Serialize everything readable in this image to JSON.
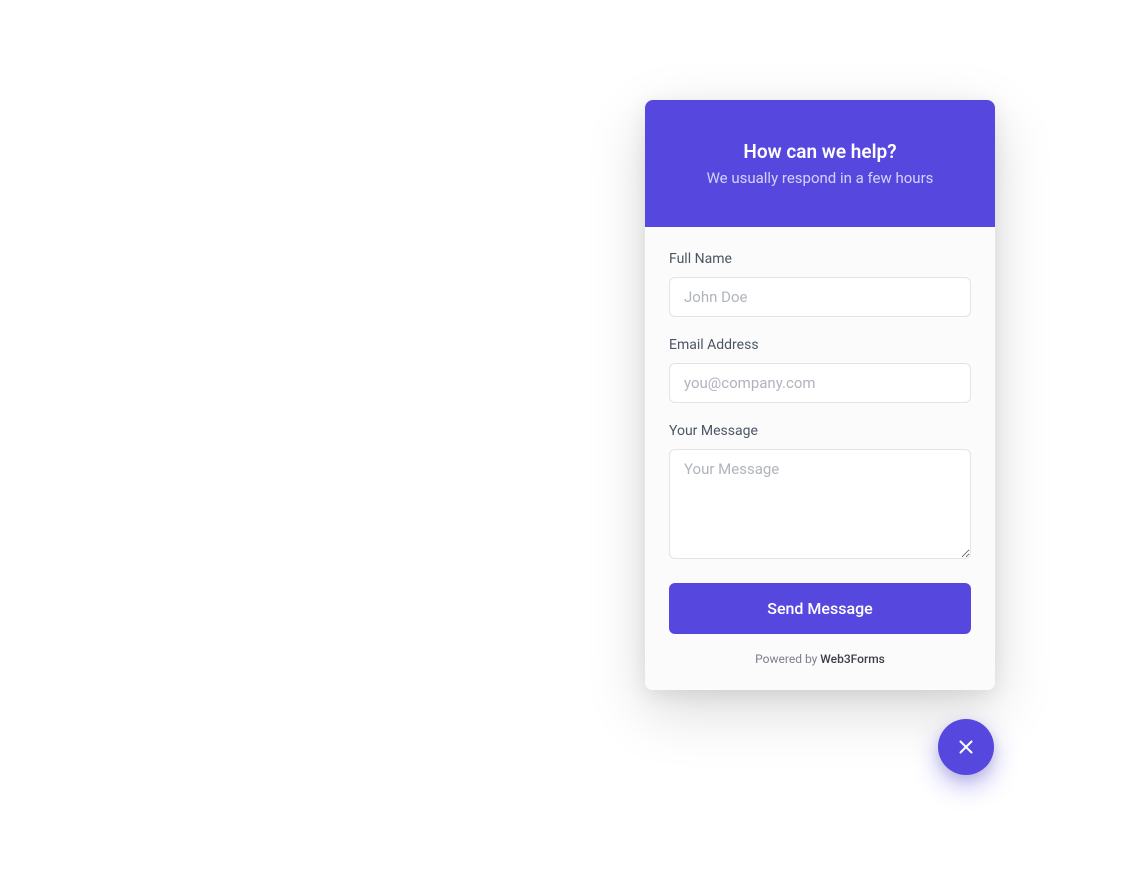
{
  "header": {
    "title": "How can we help?",
    "subtitle": "We usually respond in a few hours"
  },
  "form": {
    "fullName": {
      "label": "Full Name",
      "placeholder": "John Doe",
      "value": ""
    },
    "email": {
      "label": "Email Address",
      "placeholder": "you@company.com",
      "value": ""
    },
    "message": {
      "label": "Your Message",
      "placeholder": "Your Message",
      "value": ""
    },
    "submitLabel": "Send Message"
  },
  "footer": {
    "prefix": "Powered by ",
    "brand": "Web3Forms"
  },
  "colors": {
    "primary": "#5648DE"
  }
}
